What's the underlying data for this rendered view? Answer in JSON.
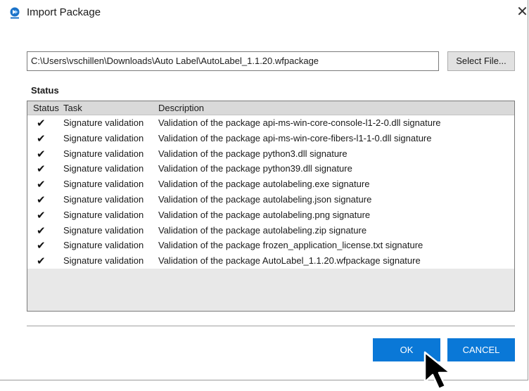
{
  "window": {
    "title": "Import Package",
    "close_glyph": "✕"
  },
  "file": {
    "path": "C:\\Users\\vschillen\\Downloads\\Auto Label\\AutoLabel_1.1.20.wfpackage",
    "select_label": "Select File..."
  },
  "status": {
    "section_label": "Status",
    "columns": {
      "status": "Status",
      "task": "Task",
      "description": "Description"
    },
    "rows": [
      {
        "check": "✔",
        "task": "Signature validation",
        "description": "Validation of the package api-ms-win-core-console-l1-2-0.dll signature"
      },
      {
        "check": "✔",
        "task": "Signature validation",
        "description": "Validation of the package api-ms-win-core-fibers-l1-1-0.dll signature"
      },
      {
        "check": "✔",
        "task": "Signature validation",
        "description": "Validation of the package python3.dll signature"
      },
      {
        "check": "✔",
        "task": "Signature validation",
        "description": "Validation of the package python39.dll signature"
      },
      {
        "check": "✔",
        "task": "Signature validation",
        "description": "Validation of the package autolabeling.exe signature"
      },
      {
        "check": "✔",
        "task": "Signature validation",
        "description": "Validation of the package autolabeling.json signature"
      },
      {
        "check": "✔",
        "task": "Signature validation",
        "description": "Validation of the package autolabeling.png signature"
      },
      {
        "check": "✔",
        "task": "Signature validation",
        "description": "Validation of the package autolabeling.zip signature"
      },
      {
        "check": "✔",
        "task": "Signature validation",
        "description": "Validation of the package frozen_application_license.txt signature"
      },
      {
        "check": "✔",
        "task": "Signature validation",
        "description": "Validation of the package AutoLabel_1.1.20.wfpackage signature"
      }
    ]
  },
  "buttons": {
    "ok": "OK",
    "cancel": "CANCEL"
  },
  "colors": {
    "accent": "#0a78d7",
    "table_bg": "#e8e8e8",
    "header_bg": "#d9d9d9"
  },
  "icons": {
    "app": "import-package-icon",
    "cursor": "mouse-pointer-icon"
  }
}
